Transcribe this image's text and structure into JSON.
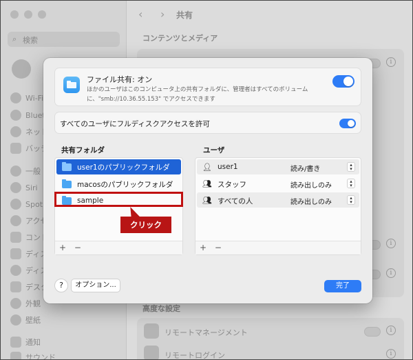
{
  "background": {
    "search_placeholder": "検索",
    "sidebar_items": [
      "Wi-Fi",
      "Bluet",
      "ネット",
      "バッテ",
      "一般",
      "Siri",
      "Spot",
      "アクセ",
      "コント",
      "ディス",
      "ディス",
      "デスク",
      "外観",
      "壁紙",
      "通知",
      "サウンド"
    ],
    "header_title": "共有",
    "section_content": "コンテンツとメディア",
    "section_advanced": "高度な設定",
    "row_remote_management": "リモートマネージメント",
    "row_remote_login": "リモートログイン"
  },
  "dialog": {
    "file_sharing_title": "ファイル共有: オン",
    "file_sharing_desc": "ほかのユーザはこのコンピュータ上の共有フォルダに、管理者はすべてのボリュームに、\"smb://10.36.55.153\" でアクセスできます",
    "full_disk_label": "すべてのユーザにフルディスクアクセスを許可",
    "shared_folders_header": "共有フォルダ",
    "users_header": "ユーザ",
    "folders": [
      {
        "name": "user1のパブリックフォルダ",
        "selected": true
      },
      {
        "name": "macosのパブリックフォルダ",
        "selected": false
      },
      {
        "name": "sample",
        "selected": false
      }
    ],
    "users": [
      {
        "icon": "person-icon",
        "name": "user1",
        "permission": "読み/書き"
      },
      {
        "icon": "group-icon",
        "name": "スタッフ",
        "permission": "読み出しのみ"
      },
      {
        "icon": "everyone-icon",
        "name": "すべての人",
        "permission": "読み出しのみ"
      }
    ],
    "add_symbol": "+",
    "remove_symbol": "−",
    "help_label": "?",
    "options_label": "オプション...",
    "done_label": "完了"
  },
  "annotation": {
    "callout_text": "クリック",
    "callout_color": "#b81515"
  },
  "colors": {
    "accent": "#2e7cf6",
    "selection": "#1f63d6"
  }
}
